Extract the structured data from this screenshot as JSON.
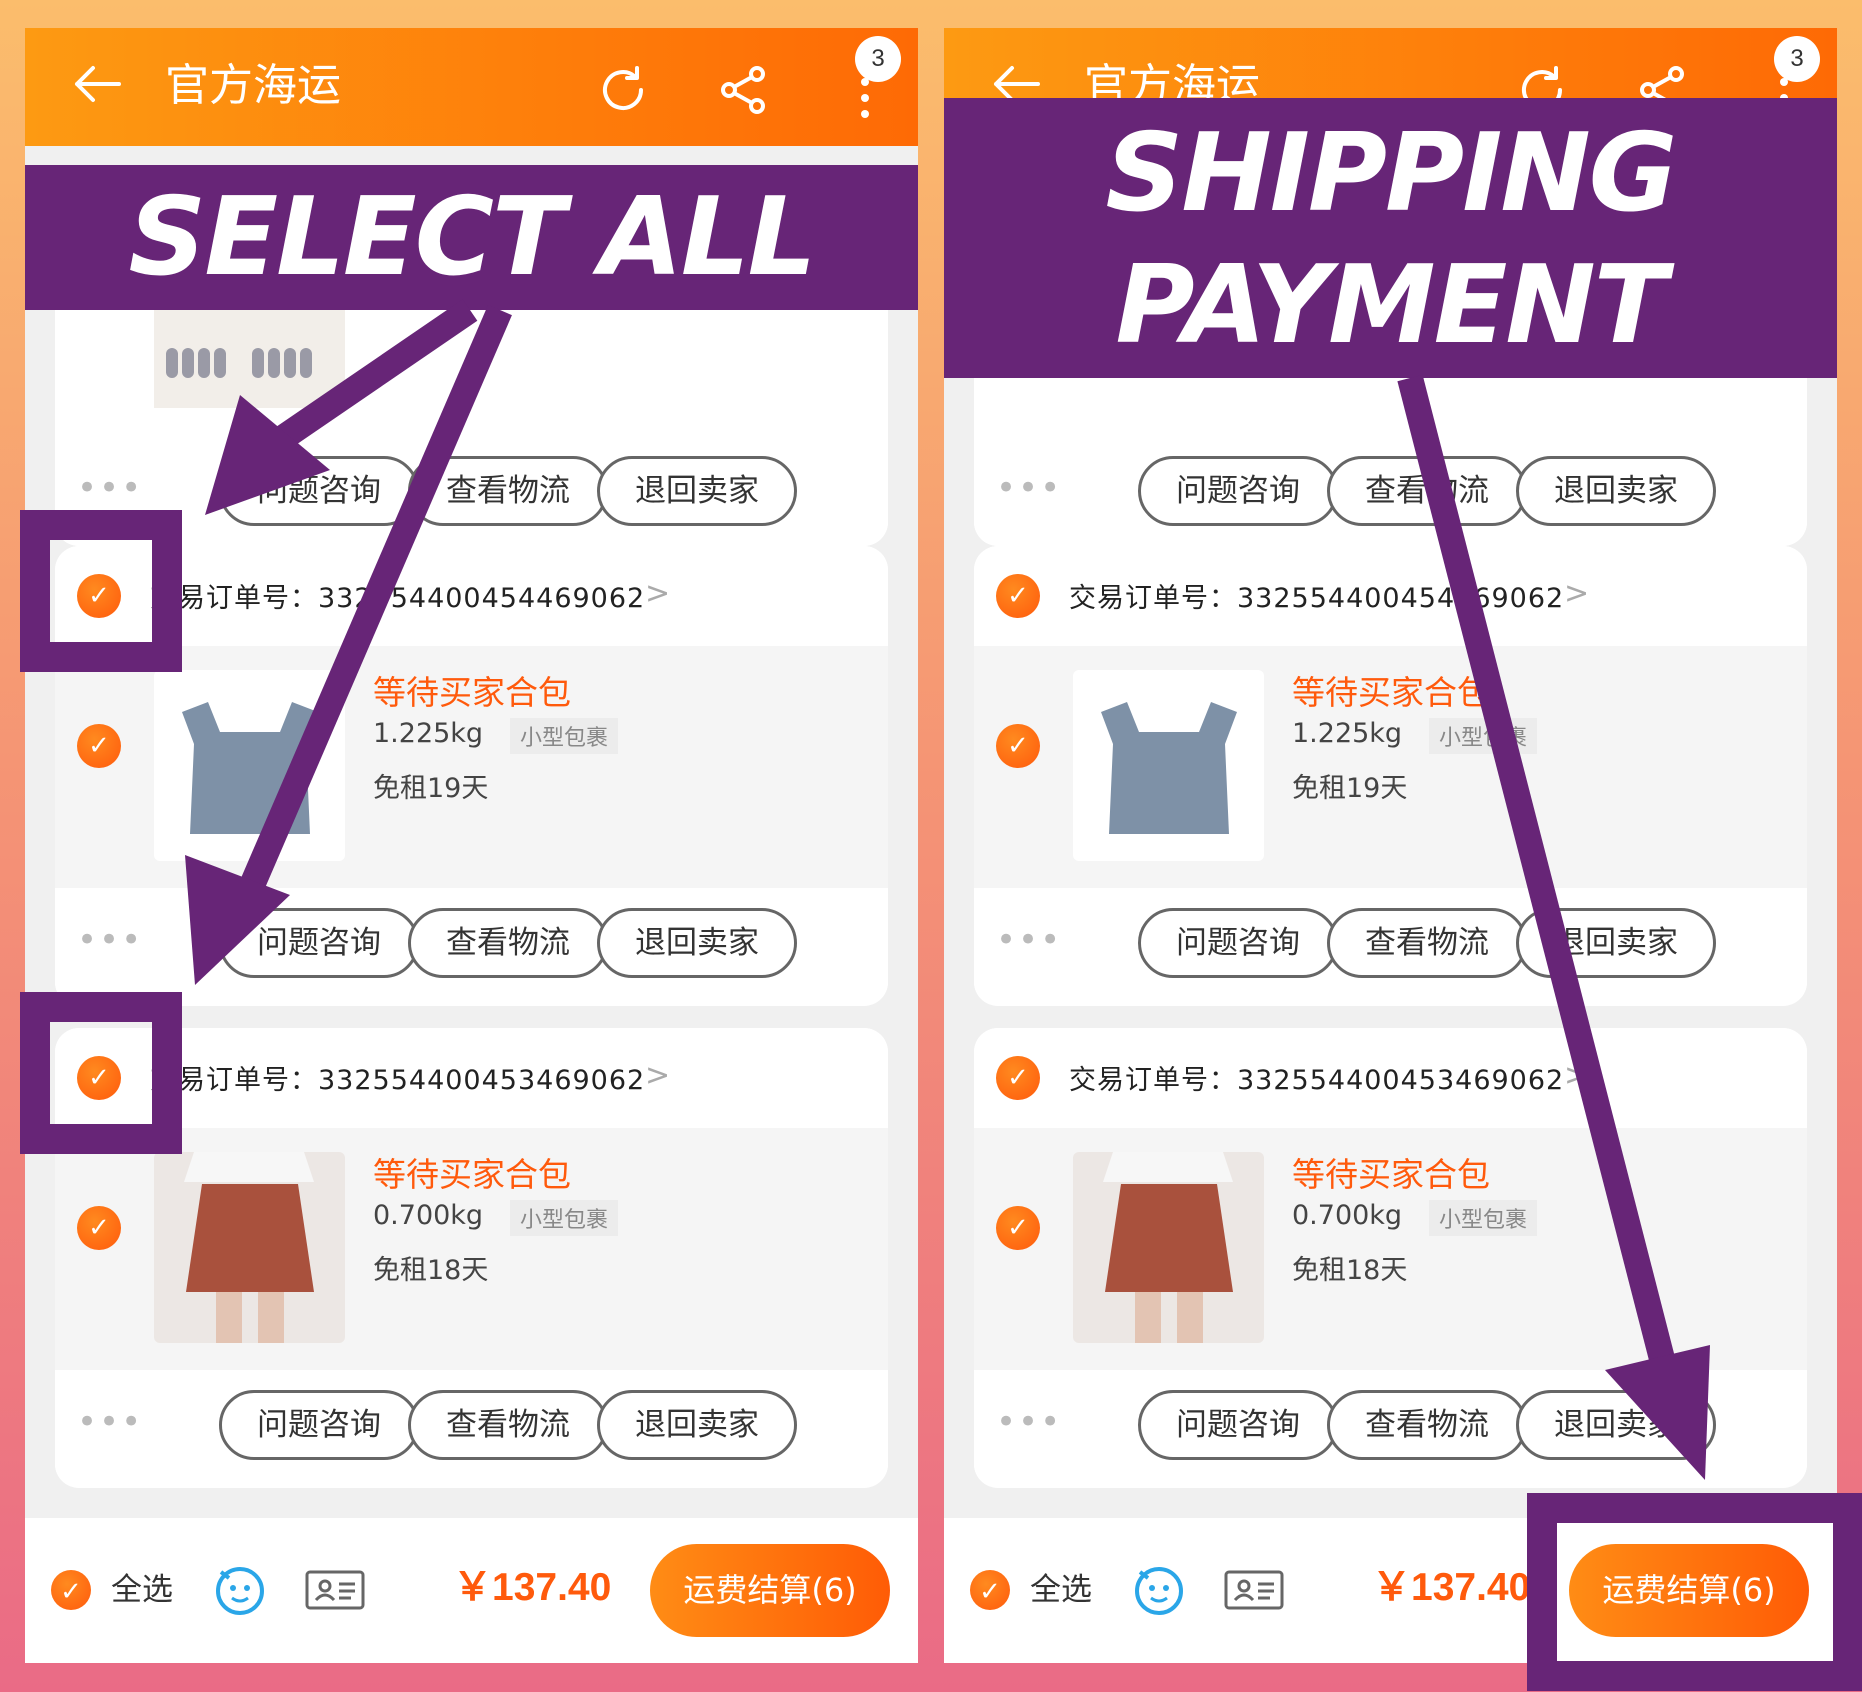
{
  "header": {
    "title": "官方海运",
    "badge_count": "3"
  },
  "orders": [
    {
      "order_label": "交易订单号：",
      "order_number": "332554400454469062",
      "status": "等待买家合包",
      "weight": "1.225kg",
      "package_tag": "小型包裹",
      "rent": "免租19天",
      "item": "top"
    },
    {
      "order_label": "交易订单号：",
      "order_number": "332554400453469062",
      "status": "等待买家合包",
      "weight": "0.700kg",
      "package_tag": "小型包裹",
      "rent": "免租18天",
      "item": "skirt"
    }
  ],
  "buttons": {
    "consult": "问题咨询",
    "logistics": "查看物流",
    "return": "退回卖家",
    "more": "•••"
  },
  "bottom": {
    "select_all": "全选",
    "total": "￥137.40",
    "pay_button": "运费结算(6)"
  },
  "annotations": {
    "left_banner": "SELECT ALL",
    "right_banner_line1": "SHIPPING",
    "right_banner_line2": "PAYMENT"
  },
  "colors": {
    "accent": "#ff5a0c",
    "header_start": "#fd9a12",
    "header_end": "#fe6a05",
    "annotation": "#672577"
  }
}
